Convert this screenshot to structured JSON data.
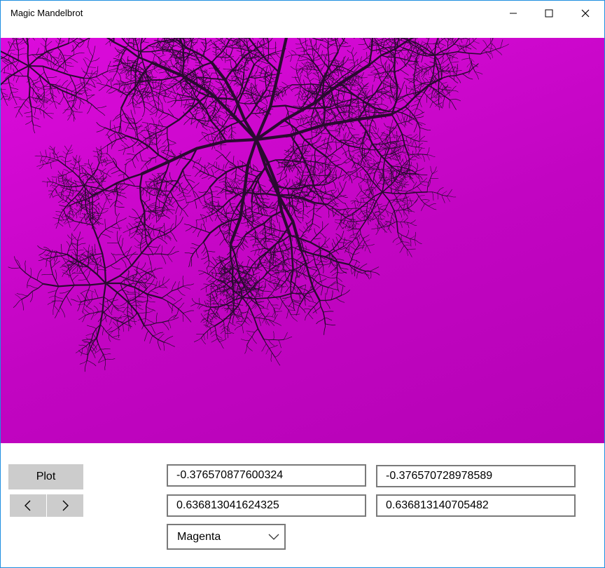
{
  "window": {
    "title": "Magic Mandelbrot",
    "accent_color": "#1e8fe0"
  },
  "canvas": {
    "description_color": "#d20bd2"
  },
  "controls": {
    "plot_label": "Plot",
    "prev_icon": "chevron-left-icon",
    "next_icon": "chevron-right-icon",
    "fields": [
      "-0.376570877600324",
      "-0.376570728978589",
      "0.636813041624325",
      "0.636813140705482"
    ],
    "color_select": {
      "selected": "Magenta"
    }
  }
}
